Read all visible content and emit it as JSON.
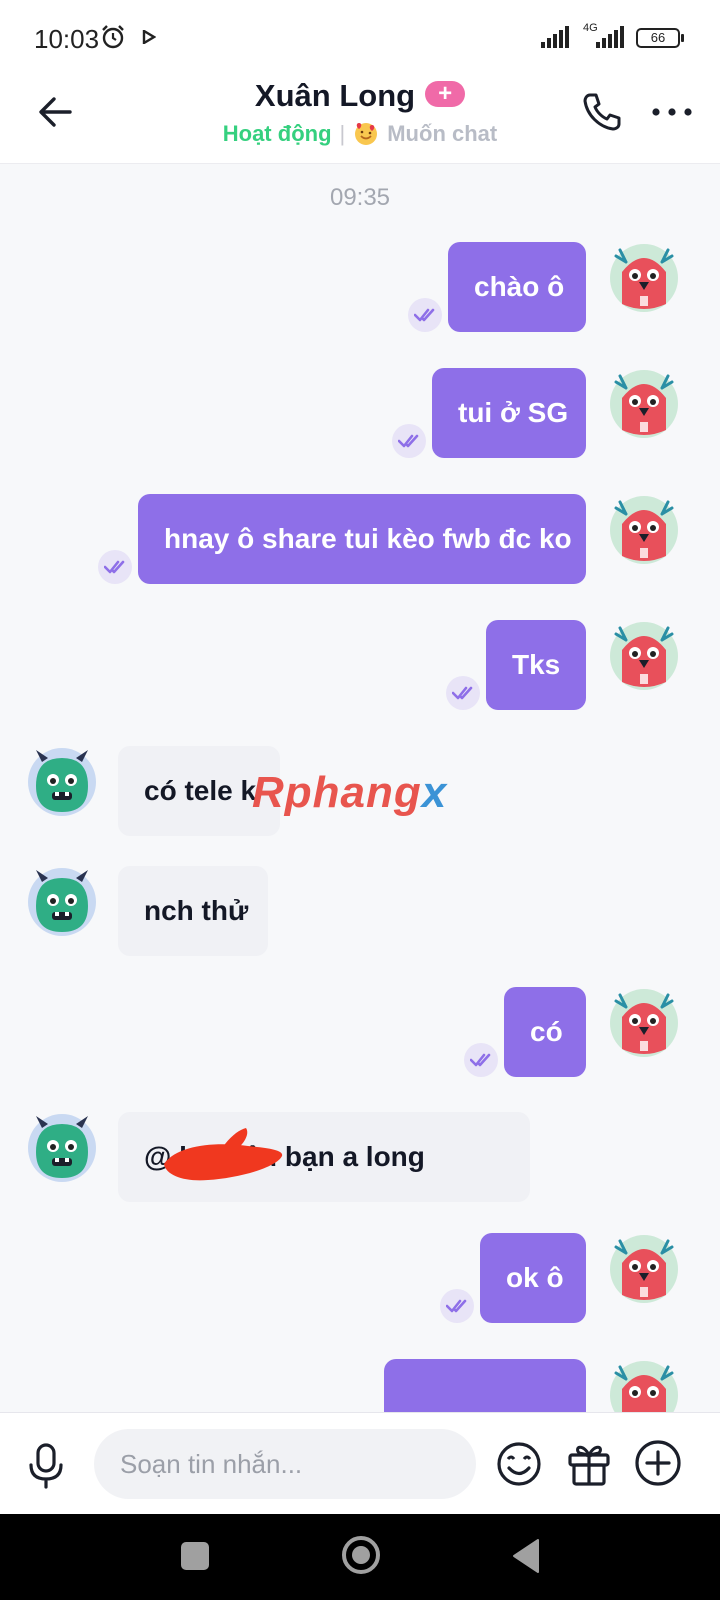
{
  "status_bar": {
    "time": "10:03",
    "network": "4G",
    "battery": "66"
  },
  "header": {
    "title": "Xuân Long",
    "plus_badge": "+",
    "status_active": "Hoạt động",
    "separator": "|",
    "status_want": "Muốn chat"
  },
  "chat": {
    "timestamp": "09:35",
    "messages": [
      {
        "direction": "out",
        "text": "chào ô"
      },
      {
        "direction": "out",
        "text": "tui ở SG"
      },
      {
        "direction": "out",
        "text": "hnay ô share tui kèo fwb đc ko"
      },
      {
        "direction": "out",
        "text": "Tks"
      },
      {
        "direction": "in",
        "text": "có tele k"
      },
      {
        "direction": "in",
        "text": "nch thử"
      },
      {
        "direction": "out",
        "text": "có"
      },
      {
        "direction": "in",
        "text": "@         hat kêu bạn a long"
      },
      {
        "direction": "out",
        "text": "ok ô"
      },
      {
        "direction": "out",
        "text": ""
      }
    ]
  },
  "watermark": {
    "part1": "Rphang",
    "part2": "x"
  },
  "input_bar": {
    "placeholder": "Soạn tin nhắn..."
  },
  "colors": {
    "outgoing_bubble": "#8e6fe8",
    "incoming_bubble": "#f0f1f5",
    "active_status": "#35d07f",
    "plus_badge": "#f06aa8"
  },
  "icons": {
    "back": "arrow-left-icon",
    "call": "phone-icon",
    "more": "more-dots-icon",
    "mic": "microphone-icon",
    "emoji": "emoji-icon",
    "gift": "gift-icon",
    "add": "plus-circle-icon",
    "seen": "double-check-icon"
  }
}
